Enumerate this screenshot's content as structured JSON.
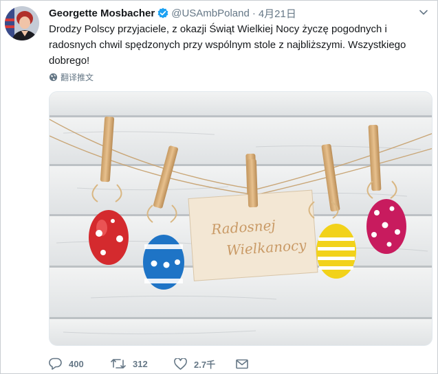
{
  "tweet": {
    "display_name": "Georgette Mosbacher",
    "handle": "@USAmbPoland",
    "separator": "·",
    "date": "4月21日",
    "text": "Drodzy Polscy przyjaciele, z okazji Świąt Wielkiej Nocy życzę pogodnych i radosnych chwil spędzonych przy wspólnym stole z najbliższymi. Wszystkiego dobrego!",
    "translate_label": "翻译推文"
  },
  "image": {
    "card_line1": "Radosnej",
    "card_line2": "Wielkanocy"
  },
  "actions": {
    "replies": "400",
    "retweets": "312",
    "likes": "2.7千"
  },
  "icons": [
    "avatar",
    "verified-badge-icon",
    "chevron-down-icon",
    "globe-icon",
    "reply-icon",
    "retweet-icon",
    "like-icon",
    "message-icon"
  ],
  "colors": {
    "name": "#14171a",
    "secondary": "#657786",
    "verified": "#1da1f2",
    "wood": "#e9ecee"
  }
}
